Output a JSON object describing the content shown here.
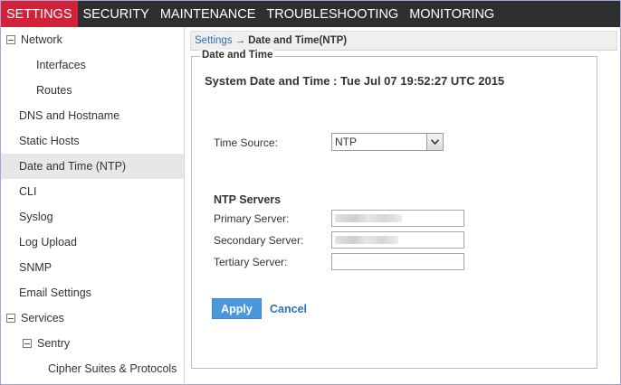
{
  "topnav": {
    "tabs": [
      "SETTINGS",
      "SECURITY",
      "MAINTENANCE",
      "TROUBLESHOOTING",
      "MONITORING"
    ],
    "active": "SETTINGS"
  },
  "sidebar": {
    "items": [
      {
        "label": "Network",
        "expander": "minus-box-icon"
      },
      {
        "label": "Interfaces"
      },
      {
        "label": "Routes"
      },
      {
        "label": "DNS and Hostname"
      },
      {
        "label": "Static Hosts"
      },
      {
        "label": "Date and Time (NTP)",
        "selected": true
      },
      {
        "label": "CLI"
      },
      {
        "label": "Syslog"
      },
      {
        "label": "Log Upload"
      },
      {
        "label": "SNMP"
      },
      {
        "label": "Email Settings"
      },
      {
        "label": "Services",
        "expander": "minus-box-icon"
      },
      {
        "label": "Sentry",
        "expander": "minus-box-icon"
      },
      {
        "label": "Cipher Suites & Protocols"
      }
    ]
  },
  "breadcrumb": {
    "root": "Settings",
    "arrow": "→",
    "current": "Date and Time(NTP)"
  },
  "panel": {
    "legend": "Date and Time",
    "system_date": "System Date and Time : Tue Jul 07 19:52:27 UTC 2015",
    "time_source_label": "Time Source:",
    "time_source_value": "NTP",
    "ntp_title": "NTP Servers",
    "primary_label": "Primary Server:",
    "secondary_label": "Secondary Server:",
    "tertiary_label": "Tertiary Server:",
    "apply_label": "Apply",
    "cancel_label": "Cancel"
  },
  "colors": {
    "nav_bg": "#2e2f31",
    "active_tab": "#d2223a",
    "link": "#2f6fb3",
    "apply_button": "#4a98db",
    "selected_row": "#e7e7e7"
  }
}
